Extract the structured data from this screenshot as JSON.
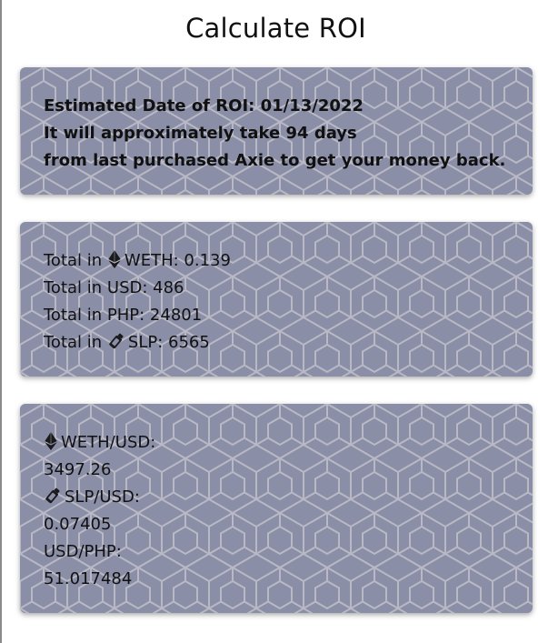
{
  "page": {
    "title": "Calculate ROI"
  },
  "roi_card": {
    "line1": "Estimated Date of ROI: 01/13/2022",
    "line2": "It will approximately take 94 days",
    "line3": "from last purchased Axie to get your money back."
  },
  "totals_card": {
    "weth_prefix": "Total in",
    "weth_text": "WETH: 0.139",
    "usd_text": "Total in USD: 486",
    "php_text": "Total in PHP: 24801",
    "slp_prefix": "Total in",
    "slp_text": "SLP: 6565"
  },
  "rates_card": {
    "weth_usd_label": "WETH/USD:",
    "weth_usd_value": "3497.26",
    "slp_usd_label": "SLP/USD:",
    "slp_usd_value": "0.07405",
    "usd_php_label": "USD/PHP:",
    "usd_php_value": "51.017484"
  },
  "icons": {
    "weth": "ethereum-icon",
    "slp": "slp-potion-icon"
  },
  "colors": {
    "card_background": "#8a8ea6",
    "pattern_stroke": "#c9c7cf",
    "text": "#111111"
  }
}
